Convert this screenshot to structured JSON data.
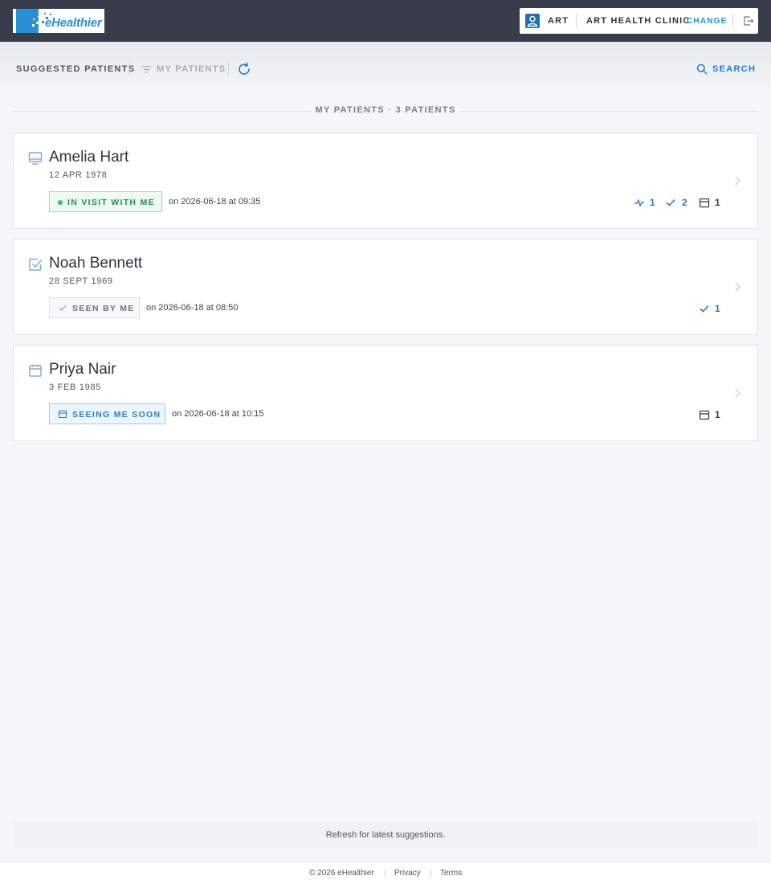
{
  "header": {
    "logo_text": "eHealthier",
    "user_name": "ART",
    "clinic_name": "ART HEALTH CLINIC",
    "change_label": "CHANGE"
  },
  "toolbar": {
    "suggested_label": "SUGGESTED PATIENTS",
    "my_patients_label": "MY PATIENTS",
    "search_label": "SEARCH"
  },
  "section": {
    "title": "MY PATIENTS · 3 PATIENTS"
  },
  "patients": [
    {
      "name": "Amelia Hart",
      "dob": "12 APR 1978",
      "icon": "monitor-icon",
      "status": "IN VISIT WITH ME",
      "status_kind": "in-visit",
      "visit_time": "on 2026-06-18 at 09:35",
      "stats": {
        "activity": "1",
        "tasks": "2",
        "appointments": "1"
      }
    },
    {
      "name": "Noah Bennett",
      "dob": "28 SEPT 1969",
      "icon": "checkbox-icon",
      "status": "SEEN BY ME",
      "status_kind": "seen",
      "visit_time": "on 2026-06-18 at 08:50",
      "stats": {
        "tasks": "1"
      }
    },
    {
      "name": "Priya Nair",
      "dob": "3 FEB 1985",
      "icon": "calendar-icon",
      "status": "SEEING ME SOON",
      "status_kind": "upcoming",
      "visit_time": "on 2026-06-18 at 10:15",
      "stats": {
        "appointments": "1"
      }
    }
  ],
  "notice": "Refresh for latest suggestions.",
  "footer": {
    "copyright": "© 2026 eHealthier",
    "privacy": "Privacy",
    "terms": "Terms"
  },
  "colors": {
    "topbar": "#393c4a",
    "accent": "#2b7cc4",
    "in_visit_green": "#1d8f4e",
    "background": "#f4f6f8"
  }
}
